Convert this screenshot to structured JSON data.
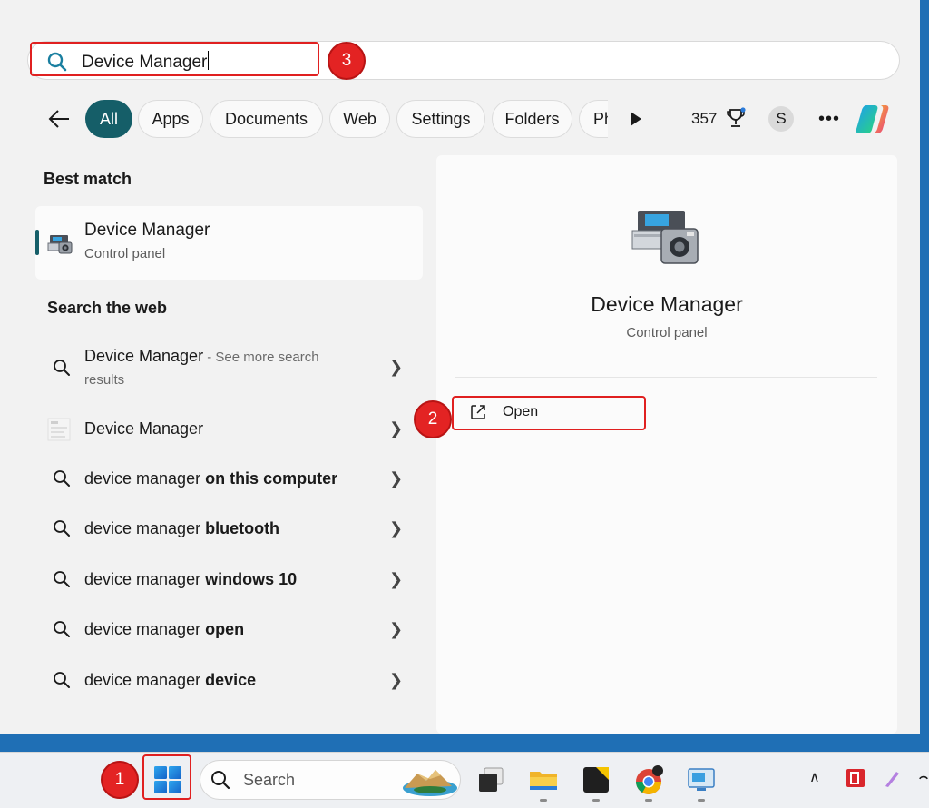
{
  "search": {
    "value": "Device Manager"
  },
  "filters": {
    "back_label": "",
    "chips": [
      "All",
      "Apps",
      "Documents",
      "Web",
      "Settings",
      "Folders",
      "Ph"
    ],
    "points": "357",
    "avatar_initial": "S",
    "more": "•••"
  },
  "best_match": {
    "heading": "Best match",
    "title": "Device Manager",
    "subtitle": "Control panel"
  },
  "web": {
    "heading": "Search the web",
    "first": {
      "text": "Device Manager",
      "suffix": " - See more search",
      "suffix2": "results"
    },
    "second": "Device Manager",
    "rows": [
      {
        "plain": "device manager ",
        "bold": "on this computer"
      },
      {
        "plain": "device manager ",
        "bold": "bluetooth"
      },
      {
        "plain": "device manager ",
        "bold": "windows 10"
      },
      {
        "plain": "device manager ",
        "bold": "open"
      },
      {
        "plain": "device manager ",
        "bold": "device"
      }
    ]
  },
  "preview": {
    "title": "Device Manager",
    "subtitle": "Control panel",
    "open_label": "Open"
  },
  "callouts": [
    "1",
    "2",
    "3"
  ],
  "taskbar": {
    "search_label": "Search"
  },
  "colors": {
    "accent": "#155e68",
    "callout": "#e32323",
    "desktop": "#1f6fb5"
  }
}
